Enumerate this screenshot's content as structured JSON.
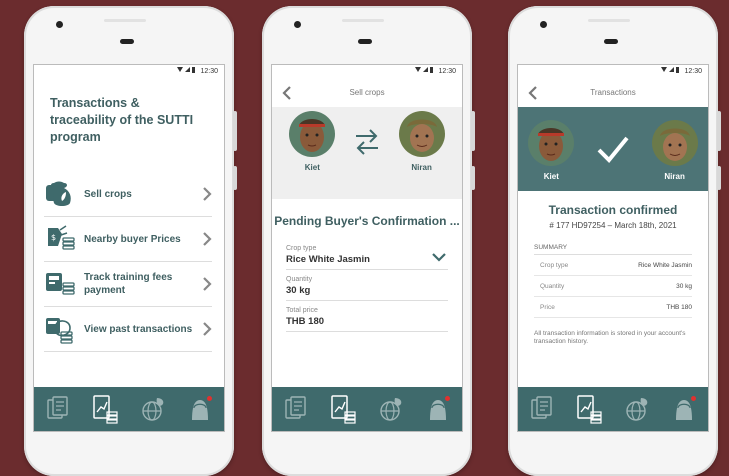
{
  "status_time": "12:30",
  "phone1": {
    "title": "Transactions & traceability of the SUTTI program",
    "menu": [
      {
        "label": "Sell crops",
        "icon": "money-bag-icon"
      },
      {
        "label": "Nearby buyer Prices",
        "icon": "price-coins-icon"
      },
      {
        "label": "Track training fees payment",
        "icon": "training-fees-icon"
      },
      {
        "label": "View past transactions",
        "icon": "past-transactions-icon"
      }
    ]
  },
  "phone2": {
    "header": "Sell crops",
    "seller": "Kiet",
    "buyer": "Niran",
    "status": "Pending Buyer's Confirmation ...",
    "fields": {
      "crop_type_label": "Crop type",
      "crop_type_value": "Rice White Jasmin",
      "quantity_label": "Quantity",
      "quantity_value": "30 kg",
      "total_label": "Total price",
      "total_value": "THB 180"
    }
  },
  "phone3": {
    "header": "Transactions",
    "seller": "Kiet",
    "buyer": "Niran",
    "title": "Transaction  confirmed",
    "txid": "# 177 HD97254 – March 18th, 2021",
    "summary_label": "SUMMARY",
    "rows": [
      {
        "k": "Crop type",
        "v": "Rice White Jasmin"
      },
      {
        "k": "Quantity",
        "v": "30 kg"
      },
      {
        "k": "Price",
        "v": "THB 180"
      }
    ],
    "note": "All transaction information is stored in your account's transaction history."
  },
  "bottom_nav": [
    "documents-icon",
    "chart-coins-icon",
    "globe-leaf-icon",
    "profile-icon"
  ],
  "colors": {
    "teal": "#3f6a6c",
    "background": "#6b2c2e",
    "title": "#3f5f61",
    "notification": "#e0312f"
  }
}
